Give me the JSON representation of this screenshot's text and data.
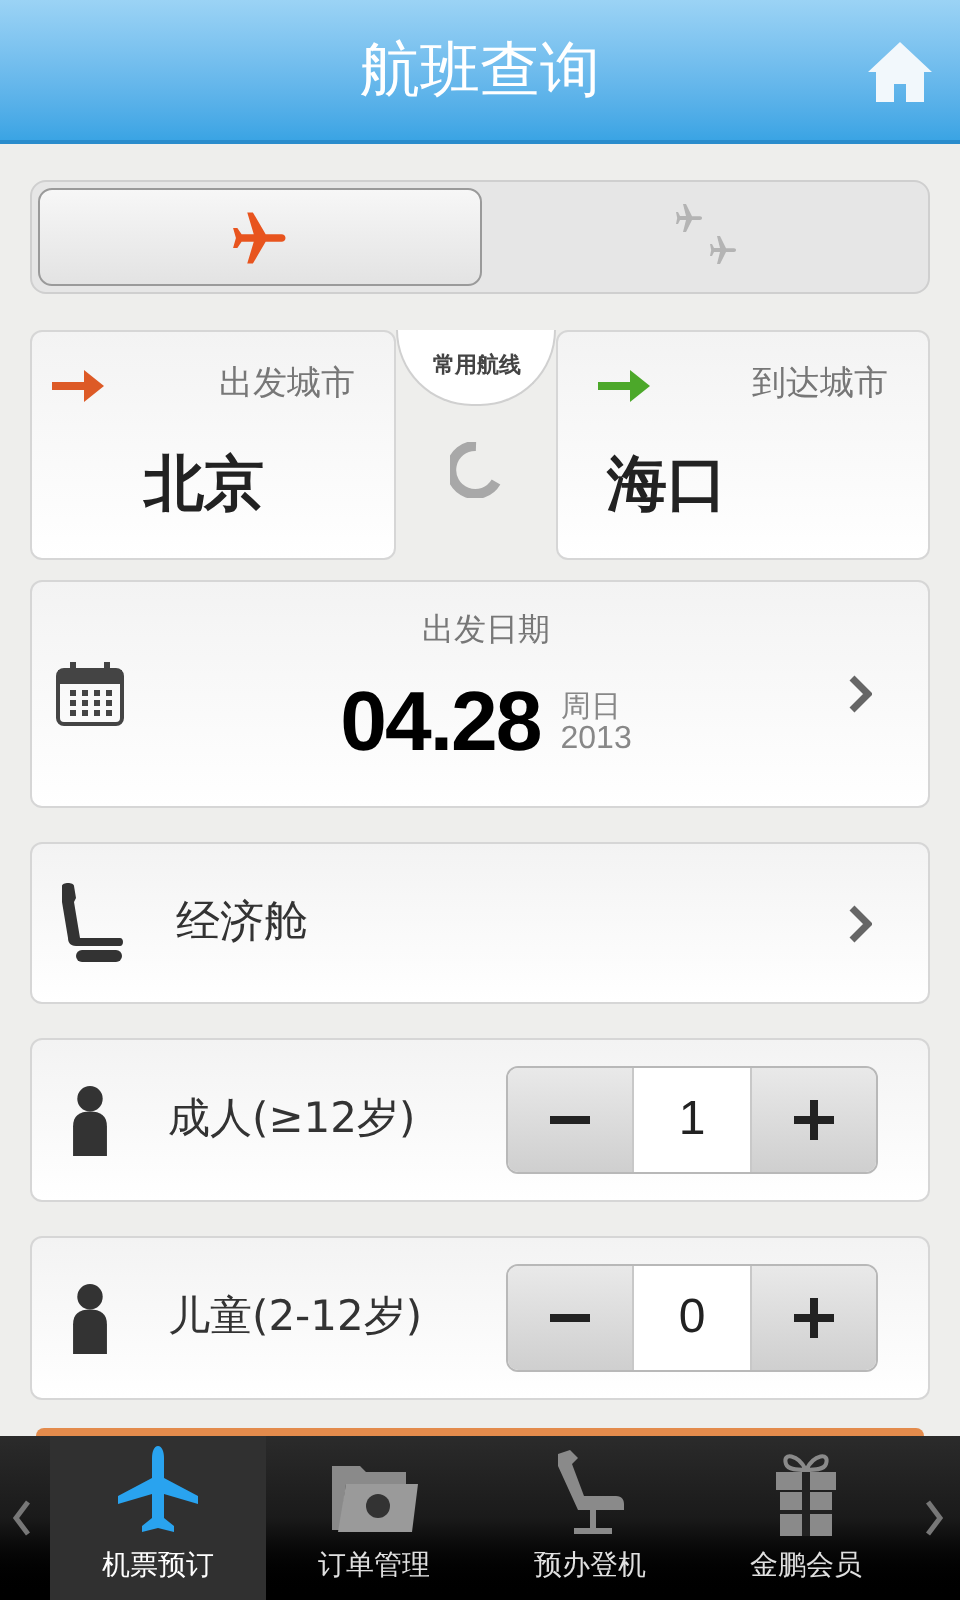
{
  "header": {
    "title": "航班查询"
  },
  "trip_types": [
    {
      "kind": "one_way",
      "selected": true
    },
    {
      "kind": "round_trip",
      "selected": false
    }
  ],
  "route": {
    "departure": {
      "label": "出发城市",
      "city": "北京"
    },
    "common_routes": "常用航线",
    "arrival": {
      "label": "到达城市",
      "city": "海口"
    }
  },
  "date": {
    "label": "出发日期",
    "day": "04.28",
    "weekday": "周日",
    "year": "2013"
  },
  "cabin": {
    "label": "经济舱"
  },
  "passengers": [
    {
      "label": "成人(≥12岁)",
      "count": "1"
    },
    {
      "label": "儿童(2-12岁)",
      "count": "0"
    }
  ],
  "tabs": [
    {
      "label": "机票预订",
      "kind": "plane",
      "selected": true
    },
    {
      "label": "订单管理",
      "kind": "folder",
      "selected": false
    },
    {
      "label": "预办登机",
      "kind": "seat",
      "selected": false
    },
    {
      "label": "金鹏会员",
      "kind": "gift",
      "selected": false
    }
  ]
}
